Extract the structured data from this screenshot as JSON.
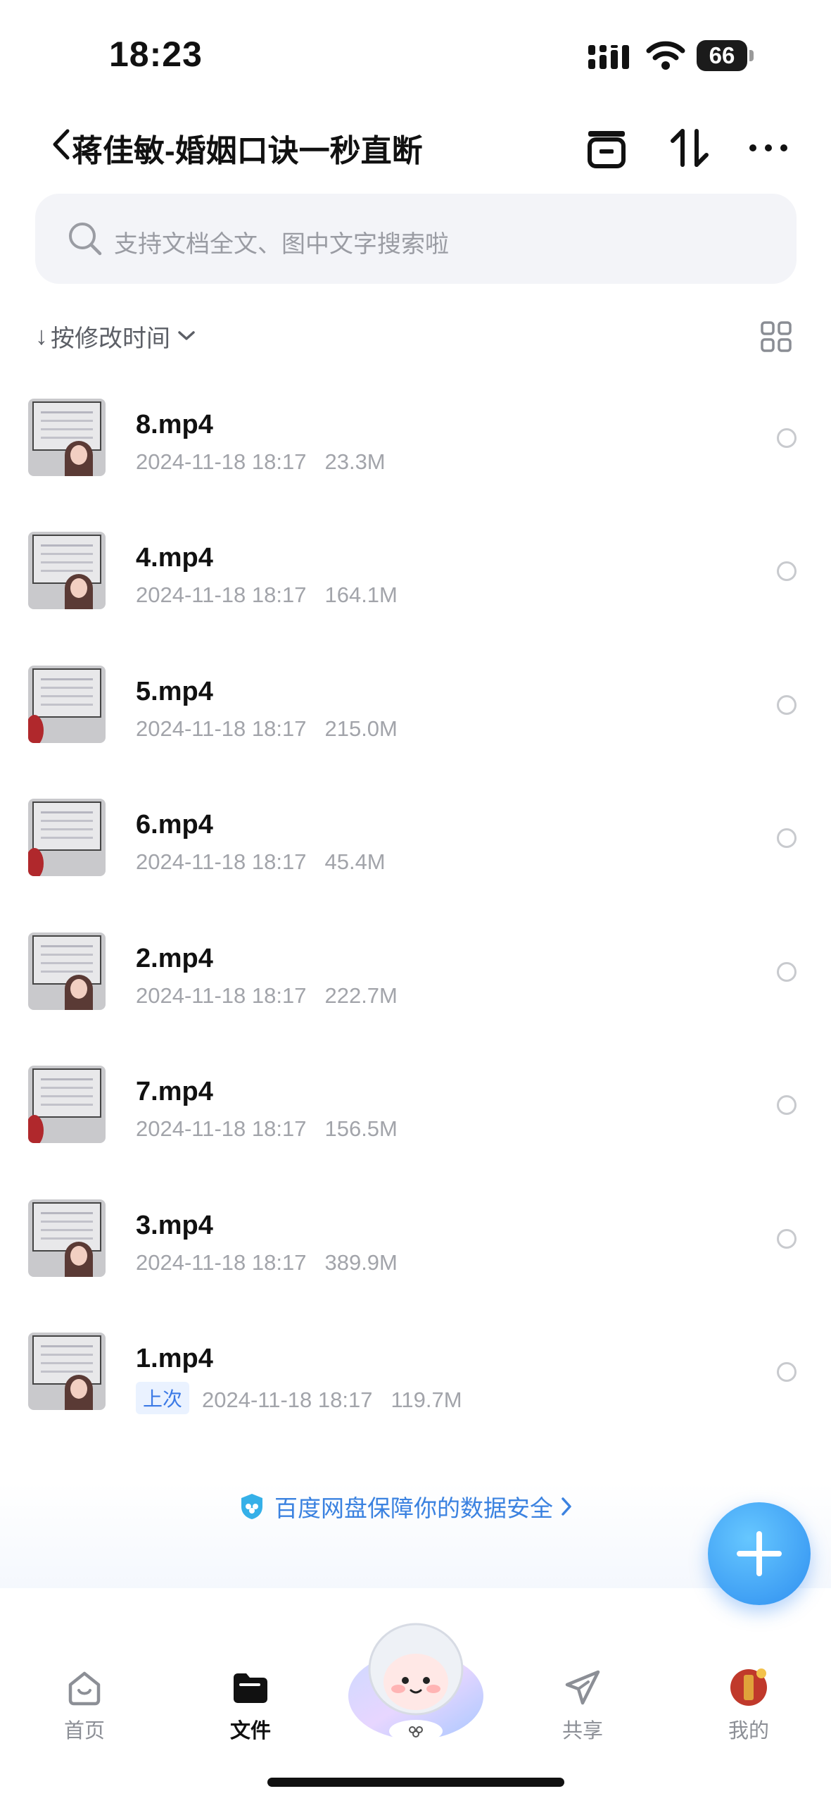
{
  "status_bar": {
    "time": "18:23",
    "battery": "66"
  },
  "header": {
    "title": "蒋佳敏-婚姻口诀一秒直断"
  },
  "search": {
    "placeholder": "支持文档全文、图中文字搜索啦"
  },
  "sort": {
    "label": "按修改时间"
  },
  "files": [
    {
      "name": "8.mp4",
      "date": "2024-11-18 18:17",
      "size": "23.3M",
      "tag": ""
    },
    {
      "name": "4.mp4",
      "date": "2024-11-18 18:17",
      "size": "164.1M",
      "tag": ""
    },
    {
      "name": "5.mp4",
      "date": "2024-11-18 18:17",
      "size": "215.0M",
      "tag": ""
    },
    {
      "name": "6.mp4",
      "date": "2024-11-18 18:17",
      "size": "45.4M",
      "tag": ""
    },
    {
      "name": "2.mp4",
      "date": "2024-11-18 18:17",
      "size": "222.7M",
      "tag": ""
    },
    {
      "name": "7.mp4",
      "date": "2024-11-18 18:17",
      "size": "156.5M",
      "tag": ""
    },
    {
      "name": "3.mp4",
      "date": "2024-11-18 18:17",
      "size": "389.9M",
      "tag": ""
    },
    {
      "name": "1.mp4",
      "date": "2024-11-18 18:17",
      "size": "119.7M",
      "tag": "上次"
    }
  ],
  "safety_banner": {
    "text": "百度网盘保障你的数据安全"
  },
  "bottom_nav": {
    "home": "首页",
    "files": "文件",
    "share": "共享",
    "mine": "我的"
  },
  "colors": {
    "accent": "#3b82e0",
    "fab": "#2f8ff0"
  },
  "icons": [
    "back-chevron-icon",
    "trash-icon",
    "sort-arrows-icon",
    "more-icon",
    "search-icon",
    "grid-view-icon",
    "shield-icon",
    "plus-icon",
    "home-icon",
    "folder-icon",
    "paper-plane-icon",
    "avatar"
  ]
}
